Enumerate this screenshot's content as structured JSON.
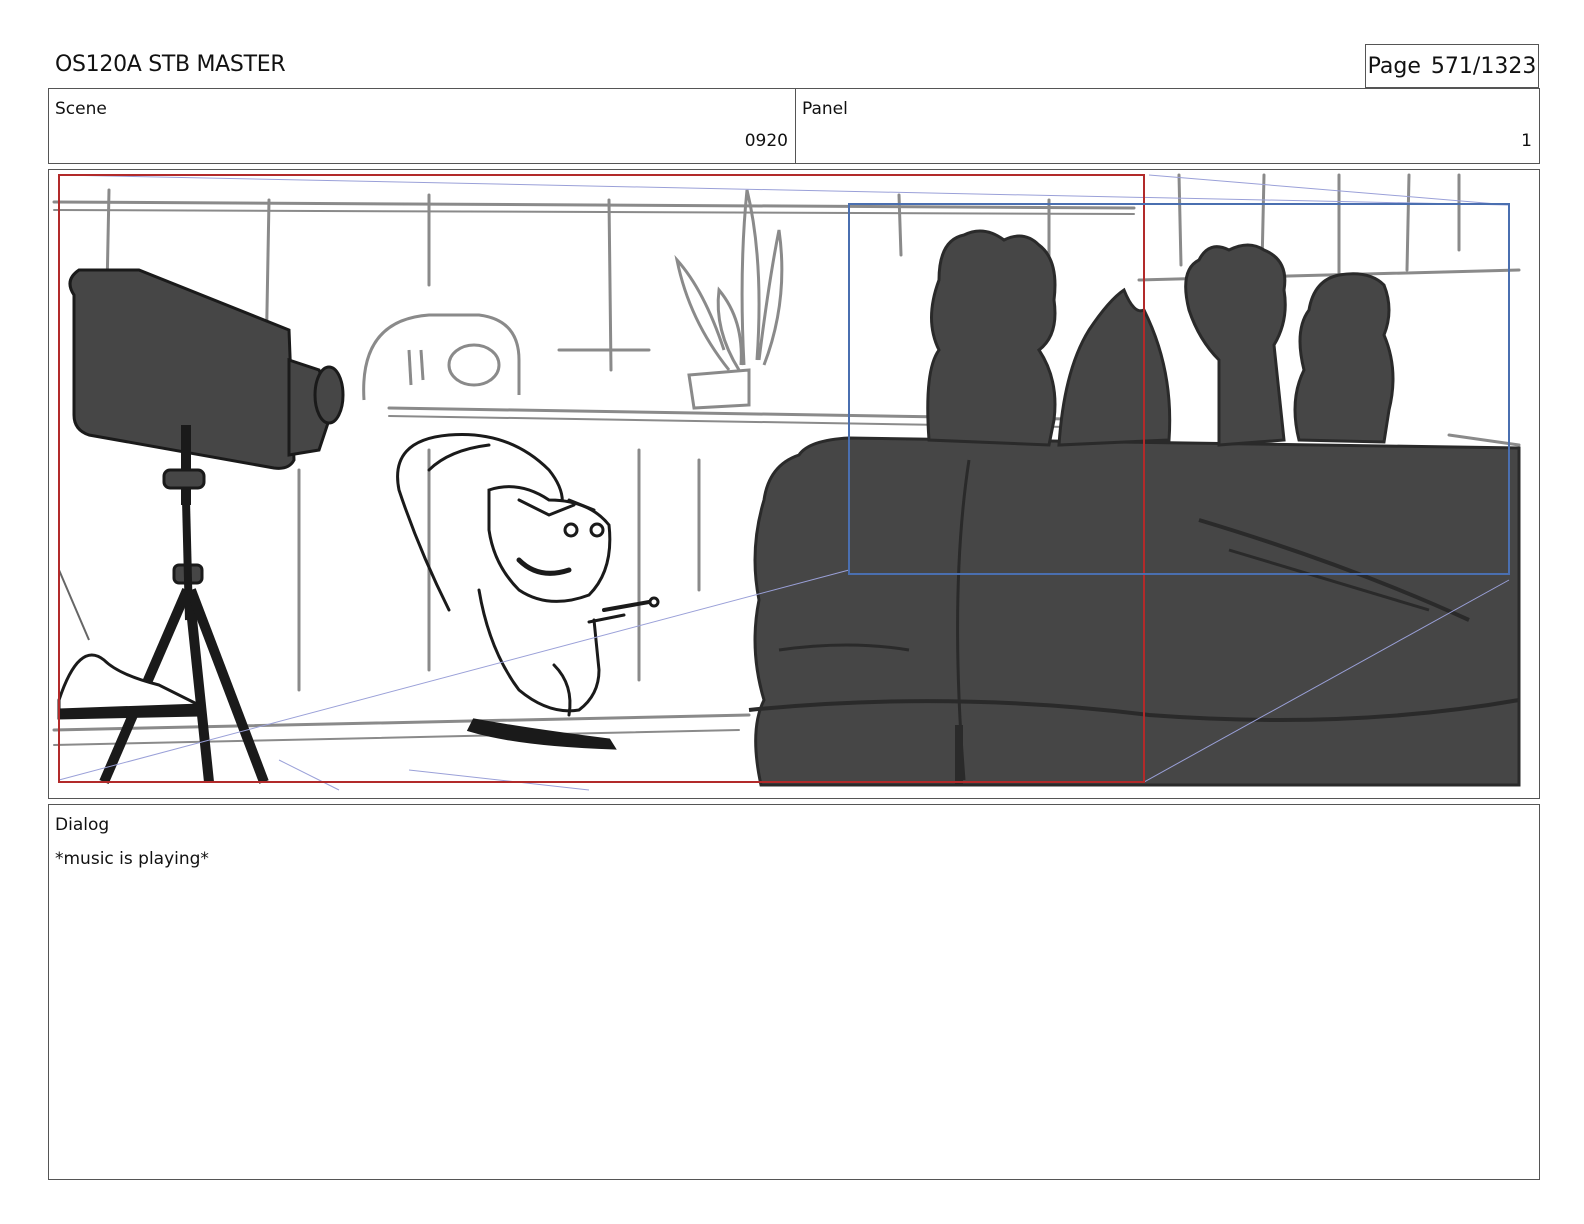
{
  "header": {
    "title": "OS120A STB MASTER",
    "page_label": "Page",
    "page_value": "571/1323"
  },
  "info": {
    "scene_label": "Scene",
    "scene_value": "0920",
    "panel_label": "Panel",
    "panel_value": "1"
  },
  "dialog": {
    "label": "Dialog",
    "text": "*music is playing*"
  },
  "colors": {
    "safe_frame": "#b22a2a",
    "camera_frame": "#4a6fb0",
    "silhouette": "#464646",
    "sketch_line": "#8a8a8a"
  }
}
